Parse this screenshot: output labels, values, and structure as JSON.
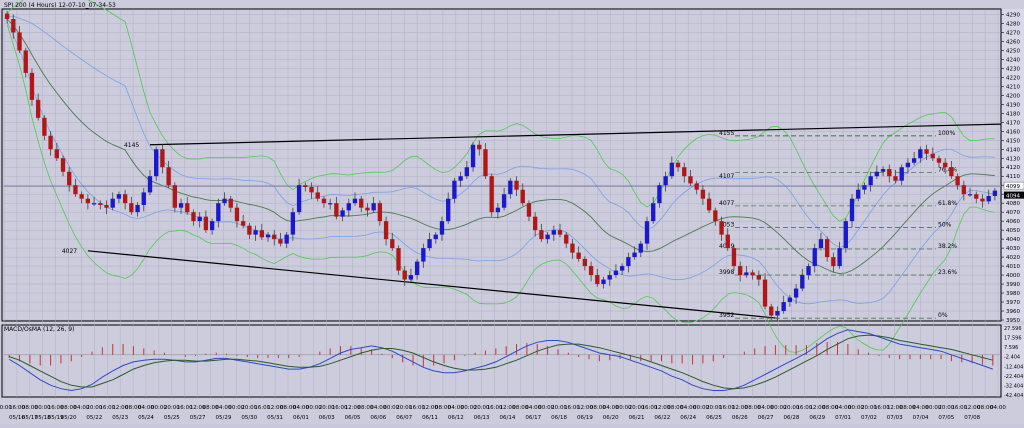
{
  "window": {
    "title": "SPI 200 (4 Hours) 12-07-10_07-34-53"
  },
  "colors": {
    "background": "#ccccdd",
    "axis_bg": "#d8d8e8",
    "grid": "#b0b0c8",
    "bull": "#1a1acc",
    "bear": "#b01818",
    "wick": "#404040",
    "ma": "#4c7a4c",
    "bb_inner": "#7aa0e8",
    "bb_outer": "#4ccc4c",
    "trendline": "#000000",
    "fib_dash": "#4c7a4c",
    "price_line": "#6a6a9a",
    "macd_line": "#2a4acc",
    "signal_line": "#2a5a2a",
    "hist": "#cc3030"
  },
  "chart_data": [
    {
      "type": "candlestick",
      "title": "SPI 200 (4 Hours) 12-07-10_07-34-53",
      "ylim": [
        3950,
        4295
      ],
      "y_ticks": [
        4290,
        4280,
        4270,
        4260,
        4250,
        4240,
        4230,
        4220,
        4210,
        4200,
        4190,
        4180,
        4170,
        4160,
        4150,
        4140,
        4130,
        4120,
        4110,
        4100,
        4090,
        4080,
        4070,
        4060,
        4050,
        4040,
        4030,
        4020,
        4010,
        4000,
        3990,
        3980,
        3970,
        3960,
        3950
      ],
      "last_price": "4094",
      "current_line": "4099",
      "x_labels": [
        {
          "time": "00:00",
          "date": ""
        },
        {
          "time": "16:00",
          "date": "05/16"
        },
        {
          "time": "08:00",
          "date": "05/17"
        },
        {
          "time": "00:00",
          "date": "05/18"
        },
        {
          "time": "16:00",
          "date": "05/19"
        },
        {
          "time": "08:00",
          "date": "05/20"
        },
        {
          "time": "04:00",
          "date": ""
        },
        {
          "time": "20:00",
          "date": "05/22"
        },
        {
          "time": "16:00",
          "date": ""
        },
        {
          "time": "12:00",
          "date": "05/23"
        },
        {
          "time": "08:00",
          "date": ""
        },
        {
          "time": "04:00",
          "date": "05/24"
        },
        {
          "time": "00:00",
          "date": ""
        },
        {
          "time": "20:00",
          "date": "05/25"
        },
        {
          "time": "16:00",
          "date": ""
        },
        {
          "time": "12:00",
          "date": "05/27"
        },
        {
          "time": "08:00",
          "date": ""
        },
        {
          "time": "04:00",
          "date": "05/29"
        },
        {
          "time": "00:00",
          "date": ""
        },
        {
          "time": "20:00",
          "date": "05/30"
        },
        {
          "time": "16:00",
          "date": ""
        },
        {
          "time": "12:00",
          "date": "05/31"
        },
        {
          "time": "08:00",
          "date": ""
        },
        {
          "time": "04:00",
          "date": "06/01"
        },
        {
          "time": "00:00",
          "date": ""
        },
        {
          "time": "20:00",
          "date": "06/03"
        },
        {
          "time": "16:00",
          "date": ""
        },
        {
          "time": "12:00",
          "date": "06/05"
        },
        {
          "time": "08:00",
          "date": ""
        },
        {
          "time": "04:00",
          "date": "06/06"
        },
        {
          "time": "00:00",
          "date": ""
        },
        {
          "time": "20:00",
          "date": "06/07"
        },
        {
          "time": "16:00",
          "date": ""
        },
        {
          "time": "12:00",
          "date": "06/11"
        },
        {
          "time": "08:00",
          "date": ""
        },
        {
          "time": "04:00",
          "date": "06/12"
        },
        {
          "time": "00:00",
          "date": ""
        },
        {
          "time": "20:00",
          "date": "06/13"
        },
        {
          "time": "16:00",
          "date": ""
        },
        {
          "time": "12:00",
          "date": "06/14"
        },
        {
          "time": "08:00",
          "date": ""
        },
        {
          "time": "04:00",
          "date": "06/17"
        },
        {
          "time": "00:00",
          "date": ""
        },
        {
          "time": "20:00",
          "date": "06/18"
        },
        {
          "time": "16:00",
          "date": ""
        },
        {
          "time": "12:00",
          "date": "06/19"
        },
        {
          "time": "08:00",
          "date": ""
        },
        {
          "time": "04:00",
          "date": "06/20"
        },
        {
          "time": "00:00",
          "date": ""
        },
        {
          "time": "20:00",
          "date": "06/21"
        },
        {
          "time": "16:00",
          "date": ""
        },
        {
          "time": "12:00",
          "date": "06/22"
        },
        {
          "time": "08:00",
          "date": ""
        },
        {
          "time": "04:00",
          "date": "06/24"
        },
        {
          "time": "00:00",
          "date": ""
        },
        {
          "time": "20:00",
          "date": "06/25"
        },
        {
          "time": "16:00",
          "date": ""
        },
        {
          "time": "12:00",
          "date": "06/26"
        },
        {
          "time": "08:00",
          "date": ""
        },
        {
          "time": "04:00",
          "date": "06/27"
        },
        {
          "time": "00:00",
          "date": ""
        },
        {
          "time": "20:00",
          "date": "06/28"
        },
        {
          "time": "16:00",
          "date": ""
        },
        {
          "time": "12:00",
          "date": "06/29"
        },
        {
          "time": "08:00",
          "date": ""
        },
        {
          "time": "04:00",
          "date": "07/01"
        },
        {
          "time": "00:00",
          "date": ""
        },
        {
          "time": "20:00",
          "date": "07/02"
        },
        {
          "time": "16:00",
          "date": ""
        },
        {
          "time": "12:00",
          "date": "07/03"
        },
        {
          "time": "08:00",
          "date": ""
        },
        {
          "time": "04:00",
          "date": "07/04"
        },
        {
          "time": "00:00",
          "date": ""
        },
        {
          "time": "20:00",
          "date": "07/05"
        },
        {
          "time": "16:00",
          "date": ""
        },
        {
          "time": "12:00",
          "date": "07/08"
        },
        {
          "time": "08:00",
          "date": ""
        },
        {
          "time": "04:00",
          "date": ""
        }
      ],
      "candles_close": [
        4285,
        4270,
        4250,
        4225,
        4195,
        4175,
        4155,
        4140,
        4130,
        4115,
        4100,
        4090,
        4085,
        4080,
        4080,
        4078,
        4075,
        4085,
        4090,
        4080,
        4070,
        4078,
        4092,
        4110,
        4140,
        4120,
        4100,
        4075,
        4080,
        4070,
        4060,
        4065,
        4050,
        4060,
        4080,
        4085,
        4075,
        4060,
        4055,
        4045,
        4050,
        4042,
        4045,
        4040,
        4035,
        4045,
        4070,
        4100,
        4098,
        4092,
        4085,
        4080,
        4080,
        4065,
        4072,
        4080,
        4085,
        4075,
        4072,
        4080,
        4060,
        4040,
        4030,
        4005,
        3995,
        4000,
        4015,
        4030,
        4040,
        4045,
        4060,
        4085,
        4105,
        4110,
        4120,
        4145,
        4140,
        4110,
        4070,
        4075,
        4090,
        4105,
        4095,
        4080,
        4065,
        4050,
        4040,
        4045,
        4050,
        4045,
        4035,
        4025,
        4018,
        4010,
        4000,
        3990,
        3995,
        4000,
        4005,
        4010,
        4020,
        4025,
        4035,
        4060,
        4080,
        4100,
        4110,
        4125,
        4120,
        4110,
        4102,
        4095,
        4085,
        4072,
        4060,
        4045,
        4030,
        4010,
        4000,
        4003,
        4000,
        3995,
        3965,
        3955,
        3960,
        3970,
        3975,
        3985,
        4000,
        4010,
        4030,
        4040,
        4020,
        4010,
        4030,
        4060,
        4085,
        4095,
        4100,
        4110,
        4115,
        4118,
        4110,
        4105,
        4120,
        4125,
        4130,
        4140,
        4135,
        4130,
        4125,
        4120,
        4110,
        4100,
        4090,
        4090,
        4085,
        4082,
        4088,
        4094
      ],
      "fib_levels": [
        {
          "price": 4155,
          "label": "100%"
        },
        {
          "price": 4114,
          "label": "76.4%"
        },
        {
          "price": 4077,
          "label": "61.8%",
          "left": "4077"
        },
        {
          "price": 4053,
          "label": "50%",
          "left": "4053"
        },
        {
          "price": 4029,
          "label": "38.2%",
          "left": "4029"
        },
        {
          "price": 4000,
          "label": "23.6%",
          "left": "3998"
        },
        {
          "price": 3952,
          "label": "0%",
          "left": "3952"
        }
      ],
      "fib_top_left": "4107",
      "fib_high_left": "4155",
      "trend_labels": {
        "upper": "4145",
        "lower": "4027"
      }
    },
    {
      "type": "line",
      "title": "MACD/OsMA (12, 26, 9)",
      "y_ticks": [
        "27.596",
        "17.596",
        "7.596",
        "-2.404",
        "-12.404",
        "-22.404",
        "-32.404",
        "-42.404"
      ],
      "ylim": [
        -45,
        30
      ],
      "macd": [
        -5,
        -12,
        -20,
        -28,
        -34,
        -38,
        -40,
        -38,
        -33,
        -25,
        -18,
        -12,
        -8,
        -6,
        -5,
        -5,
        -6,
        -8,
        -8,
        -6,
        -4,
        -4,
        -6,
        -8,
        -10,
        -12,
        -14,
        -16,
        -16,
        -14,
        -10,
        -4,
        2,
        6,
        8,
        10,
        8,
        4,
        -2,
        -8,
        -14,
        -18,
        -20,
        -20,
        -18,
        -15,
        -12,
        -8,
        -2,
        4,
        10,
        14,
        16,
        16,
        14,
        10,
        6,
        2,
        0,
        -2,
        -6,
        -10,
        -14,
        -18,
        -24,
        -28,
        -34,
        -38,
        -40,
        -40,
        -38,
        -34,
        -28,
        -22,
        -16,
        -10,
        -4,
        2,
        10,
        18,
        24,
        28,
        26,
        24,
        20,
        16,
        12,
        10,
        8,
        6,
        4,
        0,
        -4,
        -8,
        -12,
        -16
      ],
      "signal": [
        -2,
        -6,
        -12,
        -18,
        -24,
        -30,
        -34,
        -36,
        -36,
        -32,
        -28,
        -22,
        -16,
        -12,
        -9,
        -7,
        -6,
        -6,
        -7,
        -7,
        -6,
        -5,
        -5,
        -6,
        -7,
        -9,
        -11,
        -13,
        -14,
        -14,
        -13,
        -10,
        -6,
        -2,
        2,
        5,
        7,
        7,
        5,
        2,
        -3,
        -8,
        -12,
        -15,
        -17,
        -17,
        -16,
        -14,
        -10,
        -6,
        -1,
        4,
        8,
        11,
        12,
        12,
        10,
        8,
        5,
        2,
        -1,
        -4,
        -8,
        -12,
        -16,
        -20,
        -25,
        -30,
        -34,
        -37,
        -38,
        -37,
        -34,
        -30,
        -25,
        -19,
        -13,
        -7,
        -1,
        6,
        12,
        18,
        21,
        22,
        21,
        19,
        16,
        14,
        12,
        10,
        8,
        6,
        3,
        0,
        -3,
        -6
      ]
    }
  ]
}
